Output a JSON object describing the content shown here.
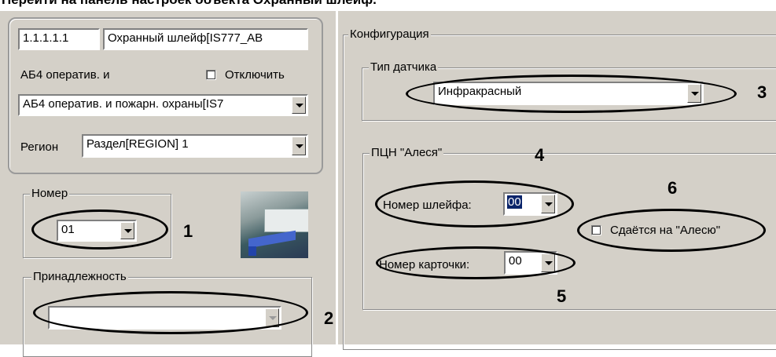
{
  "caption": "Перейти на панель настроек объекта Охранный шлейф.",
  "object_panel": {
    "id": "1.1.1.1.1",
    "name": "Охранный шлейф[IS777_AB",
    "parent_label": "АБ4 оператив. и",
    "disable_label": "Отключить",
    "device_select": "АБ4 оператив. и пожарн. охраны[IS7",
    "region_label": "Регион",
    "region_select": "Раздел[REGION] 1"
  },
  "number_group": {
    "title": "Номер",
    "value": "01"
  },
  "membership_group": {
    "title": "Принадлежность",
    "value": ""
  },
  "configuration": {
    "title": "Конфигурация",
    "sensor_type": {
      "title": "Тип датчика",
      "value": "Инфракрасный"
    },
    "pcn": {
      "title": "ПЦН \"Алеся\"",
      "loop_label": "Номер шлейфа:",
      "loop_value": "00",
      "card_label": "Номер карточки:",
      "card_value": "00",
      "surrender_label": "Сдаётся на \"Алесю\""
    }
  },
  "callouts": [
    "1",
    "2",
    "3",
    "4",
    "5",
    "6"
  ],
  "icons": {
    "object_image": "security-loop-icon"
  },
  "colors": {
    "panel": "#d4d0c8",
    "selection": "#0a246a"
  }
}
